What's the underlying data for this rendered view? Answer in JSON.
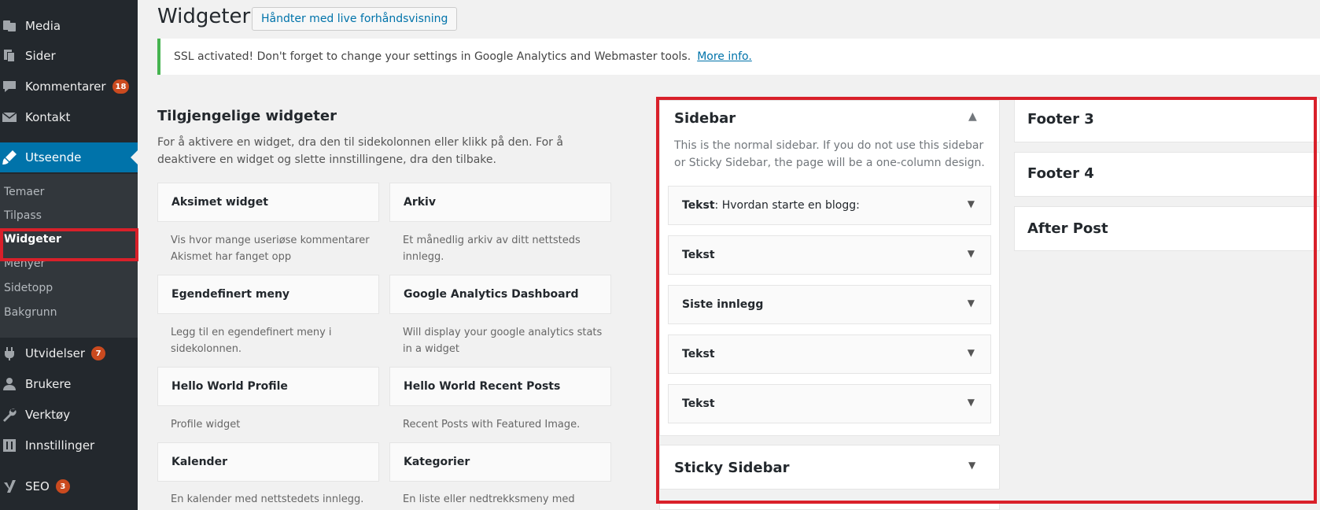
{
  "admin_menu": {
    "items": [
      {
        "label": "Media"
      },
      {
        "label": "Sider"
      },
      {
        "label": "Kommentarer",
        "badge": "18"
      },
      {
        "label": "Kontakt"
      },
      {
        "label": "Utseende"
      },
      {
        "label": "Utvidelser",
        "badge": "7"
      },
      {
        "label": "Brukere"
      },
      {
        "label": "Verktøy"
      },
      {
        "label": "Innstillinger"
      },
      {
        "label": "SEO",
        "badge": "3"
      }
    ],
    "submenu": [
      "Temaer",
      "Tilpass",
      "Widgeter",
      "Menyer",
      "Sidetopp",
      "Bakgrunn"
    ]
  },
  "header": {
    "title": "Widgeter",
    "live_button": "Håndter med live forhåndsvisning"
  },
  "notice": {
    "text": "SSL activated!  Don't forget to change your settings in Google Analytics and Webmaster tools.",
    "link": "More info."
  },
  "available": {
    "title": "Tilgjengelige widgeter",
    "description": "For å aktivere en widget, dra den til sidekolonnen eller klikk på den. For å deaktivere en widget og slette innstillingene, dra den tilbake.",
    "widgets": [
      {
        "name": "Aksimet widget",
        "desc": "Vis hvor mange useriøse kommentarer Akismet har fanget opp"
      },
      {
        "name": "Arkiv",
        "desc": "Et månedlig arkiv av ditt nettsteds innlegg."
      },
      {
        "name": "Egendefinert meny",
        "desc": "Legg til en egendefinert meny i sidekolonnen."
      },
      {
        "name": "Google Analytics Dashboard",
        "desc": "Will display your google analytics stats in a widget"
      },
      {
        "name": "Hello World Profile",
        "desc": "Profile widget"
      },
      {
        "name": "Hello World Recent Posts",
        "desc": "Recent Posts with Featured Image."
      },
      {
        "name": "Kalender",
        "desc": "En kalender med nettstedets innlegg."
      },
      {
        "name": "Kategorier",
        "desc": "En liste eller nedtrekksmeny med"
      }
    ]
  },
  "sidebar": {
    "title": "Sidebar",
    "description": "This is the normal sidebar. If you do not use this sidebar or Sticky Sidebar, the page will be a one-column design.",
    "widgets": [
      {
        "title": "Tekst",
        "subtitle": ": Hvordan starte en blogg:"
      },
      {
        "title": "Tekst",
        "subtitle": ""
      },
      {
        "title": "Siste innlegg",
        "subtitle": ""
      },
      {
        "title": "Tekst",
        "subtitle": ""
      },
      {
        "title": "Tekst",
        "subtitle": ""
      }
    ]
  },
  "sticky_sidebar": {
    "title": "Sticky Sidebar"
  },
  "footers": [
    "Footer 3",
    "Footer 4",
    "After Post"
  ],
  "colors": {
    "accent": "#0073aa",
    "highlight": "#d9202a",
    "notice_border": "#46b450",
    "badge": "#ca4a1f"
  }
}
